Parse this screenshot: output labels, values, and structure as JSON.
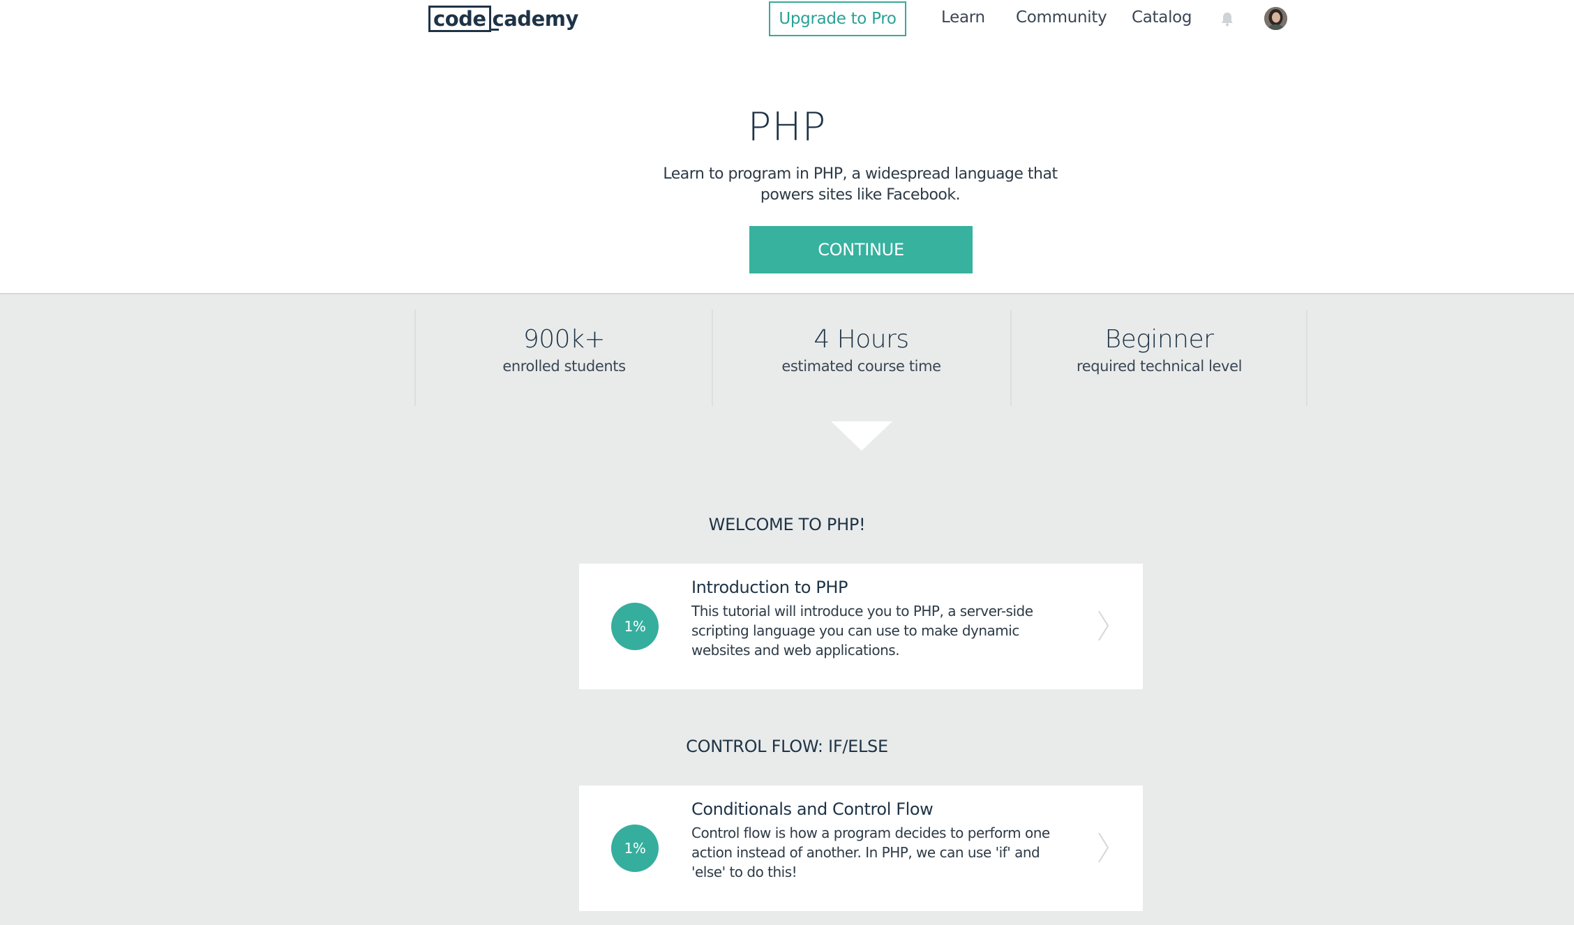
{
  "nav": {
    "logo_box": "code",
    "logo_rest": "cademy",
    "upgrade_label": "Upgrade to Pro",
    "links": [
      "Learn",
      "Community",
      "Catalog"
    ],
    "icons": [
      "bell-icon",
      "avatar"
    ]
  },
  "hero": {
    "title": "PHP",
    "description": "Learn to program in PHP, a widespread language that powers sites like Facebook.",
    "continue_label": "CONTINUE"
  },
  "stats": [
    {
      "value": "900k+",
      "label": "enrolled students"
    },
    {
      "value": "4 Hours",
      "label": "estimated course time"
    },
    {
      "value": "Beginner",
      "label": "required technical level"
    }
  ],
  "sections": [
    {
      "heading": "WELCOME TO PHP!",
      "card": {
        "progress": "1%",
        "title": "Introduction to PHP",
        "description": "This tutorial will introduce you to PHP, a server-side scripting language you can use to make dynamic websites and web applications."
      }
    },
    {
      "heading": "CONTROL FLOW: IF/ELSE",
      "card": {
        "progress": "1%",
        "title": "Conditionals and Control Flow",
        "description": "Control flow is how a program decides to perform one action instead of another. In PHP, we can use 'if' and 'else' to do this!"
      }
    }
  ],
  "colors": {
    "accent": "#36b29f",
    "navy": "#1e3346",
    "background": "#e9ebea"
  }
}
